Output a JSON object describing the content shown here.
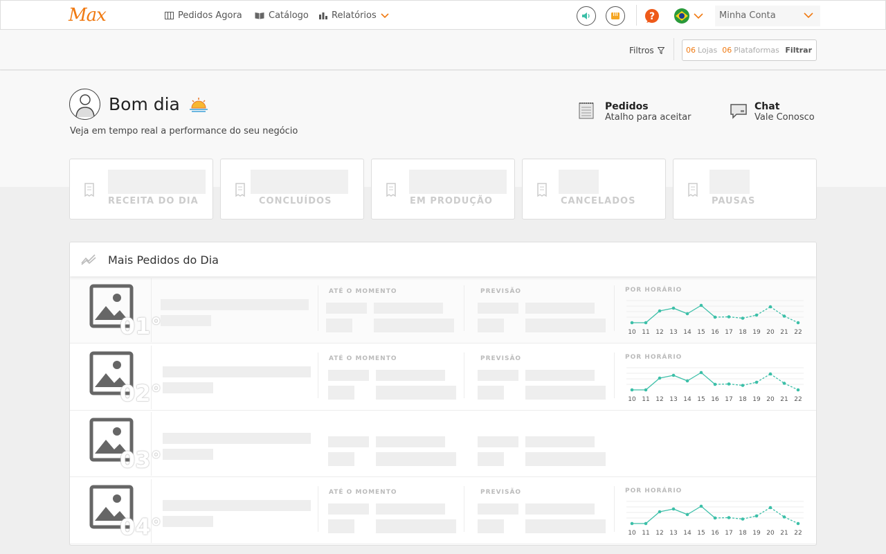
{
  "header": {
    "logo": "Max",
    "nav": [
      {
        "label": "Pedidos Agora",
        "icon": "grid-icon"
      },
      {
        "label": "Catálogo",
        "icon": "book-icon"
      },
      {
        "label": "Relatórios",
        "icon": "bar-chart-icon"
      }
    ],
    "account_label": "Minha Conta"
  },
  "filter_bar": {
    "filters_label": "Filtros",
    "stores_count": "06",
    "stores_label": "Lojas",
    "platforms_count": "06",
    "platforms_label": "Plataformas",
    "apply_label": "Filtrar"
  },
  "hero": {
    "greeting": "Bom dia",
    "subtitle": "Veja em tempo real a performance do seu negócio",
    "shortcuts": [
      {
        "title": "Pedidos",
        "subtitle": "Atalho para aceitar",
        "icon": "notepad-icon"
      },
      {
        "title": "Chat",
        "subtitle": "Vale Conosco",
        "icon": "chat-icon"
      }
    ]
  },
  "stats": [
    {
      "label": "RECEITA DO DIA"
    },
    {
      "label": "CONCLUÍDOS"
    },
    {
      "label": "EM PRODUÇÃO"
    },
    {
      "label": "CANCELADOS"
    },
    {
      "label": "PAUSAS"
    }
  ],
  "top_orders": {
    "title": "Mais Pedidos do Dia",
    "col_until_now": "ATÉ O MOMENTO",
    "col_forecast": "PREVISÃO",
    "col_hourly": "POR HORÁRIO",
    "hours": [
      "10",
      "11",
      "12",
      "13",
      "14",
      "15",
      "16",
      "17",
      "18",
      "19",
      "20",
      "21",
      "22"
    ],
    "rows": [
      {
        "rank": "01°",
        "has_chart": true
      },
      {
        "rank": "02°",
        "has_chart": true
      },
      {
        "rank": "03°",
        "has_chart": false
      },
      {
        "rank": "04°",
        "has_chart": true
      }
    ],
    "chart_color": "#3cbfa8"
  },
  "colors": {
    "brand": "#f07a12",
    "accent_teal": "#3cbfa8"
  }
}
